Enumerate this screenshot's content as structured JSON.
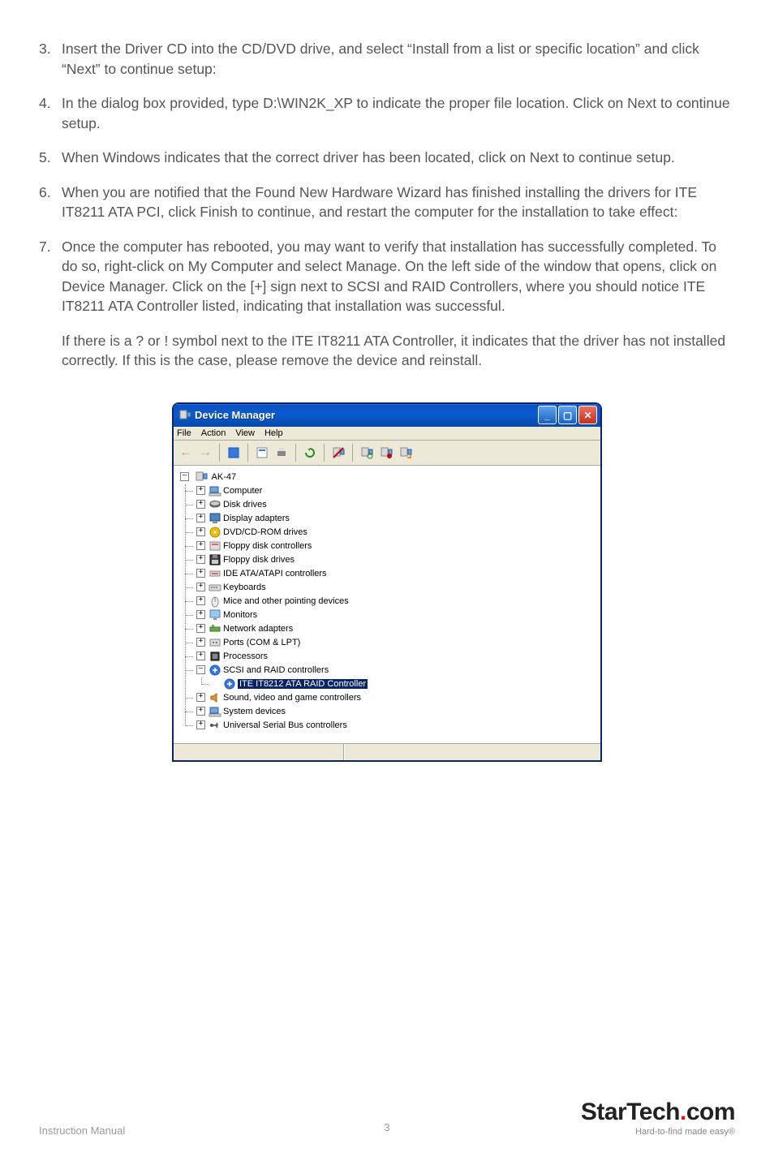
{
  "steps": [
    {
      "n": "3.",
      "text": "Insert the Driver CD into the CD/DVD drive, and select “Install from a list or specific location” and click “Next” to continue setup:"
    },
    {
      "n": "4.",
      "text": "In the dialog box provided, type D:\\WIN2K_XP to indicate the proper file location. Click on Next to continue setup."
    },
    {
      "n": "5.",
      "text": "When Windows indicates that the correct driver has been located, click on Next to continue setup."
    },
    {
      "n": "6.",
      "text": "When you are notified that the Found New Hardware Wizard has finished installing the drivers for ITE IT8211 ATA PCI, click Finish to continue, and restart the computer for the installation to take effect:"
    },
    {
      "n": "7.",
      "text": "Once the computer has rebooted, you may want to verify that installation has successfully completed. To do so, right-click on My Computer and select Manage. On the left side of the window that opens, click on Device Manager. Click on the [+] sign next to SCSI and RAID Controllers, where you should notice ITE IT8211 ATA Controller listed, indicating that installation was successful."
    }
  ],
  "followup": "If there is a ? or ! symbol next to the ITE IT8211 ATA Controller, it indicates that the driver has not installed correctly. If this is the case, please remove the device and reinstall.",
  "dm": {
    "title": "Device Manager",
    "menu": [
      "File",
      "Action",
      "View",
      "Help"
    ],
    "root": "AK-47",
    "nodes": [
      {
        "icon": "computer",
        "label": "Computer",
        "exp": "+"
      },
      {
        "icon": "disk",
        "label": "Disk drives",
        "exp": "+"
      },
      {
        "icon": "display",
        "label": "Display adapters",
        "exp": "+"
      },
      {
        "icon": "dvd",
        "label": "DVD/CD-ROM drives",
        "exp": "+"
      },
      {
        "icon": "floppyctrl",
        "label": "Floppy disk controllers",
        "exp": "+"
      },
      {
        "icon": "floppy",
        "label": "Floppy disk drives",
        "exp": "+"
      },
      {
        "icon": "ide",
        "label": "IDE ATA/ATAPI controllers",
        "exp": "+"
      },
      {
        "icon": "keyboard",
        "label": "Keyboards",
        "exp": "+"
      },
      {
        "icon": "mouse",
        "label": "Mice and other pointing devices",
        "exp": "+"
      },
      {
        "icon": "monitor",
        "label": "Monitors",
        "exp": "+"
      },
      {
        "icon": "network",
        "label": "Network adapters",
        "exp": "+"
      },
      {
        "icon": "ports",
        "label": "Ports (COM & LPT)",
        "exp": "+"
      },
      {
        "icon": "cpu",
        "label": "Processors",
        "exp": "+"
      },
      {
        "icon": "scsi",
        "label": "SCSI and RAID controllers",
        "exp": "-",
        "children": [
          {
            "icon": "scsi",
            "label": "ITE IT8212 ATA RAID Controller",
            "selected": true
          }
        ]
      },
      {
        "icon": "sound",
        "label": "Sound, video and game controllers",
        "exp": "+"
      },
      {
        "icon": "system",
        "label": "System devices",
        "exp": "+"
      },
      {
        "icon": "usb",
        "label": "Universal Serial Bus controllers",
        "exp": "+"
      }
    ]
  },
  "footer": {
    "left": "Instruction Manual",
    "page": "3",
    "logo": "StarTech",
    "logoSuffix": "com",
    "tagline": "Hard-to-find made easy®"
  }
}
